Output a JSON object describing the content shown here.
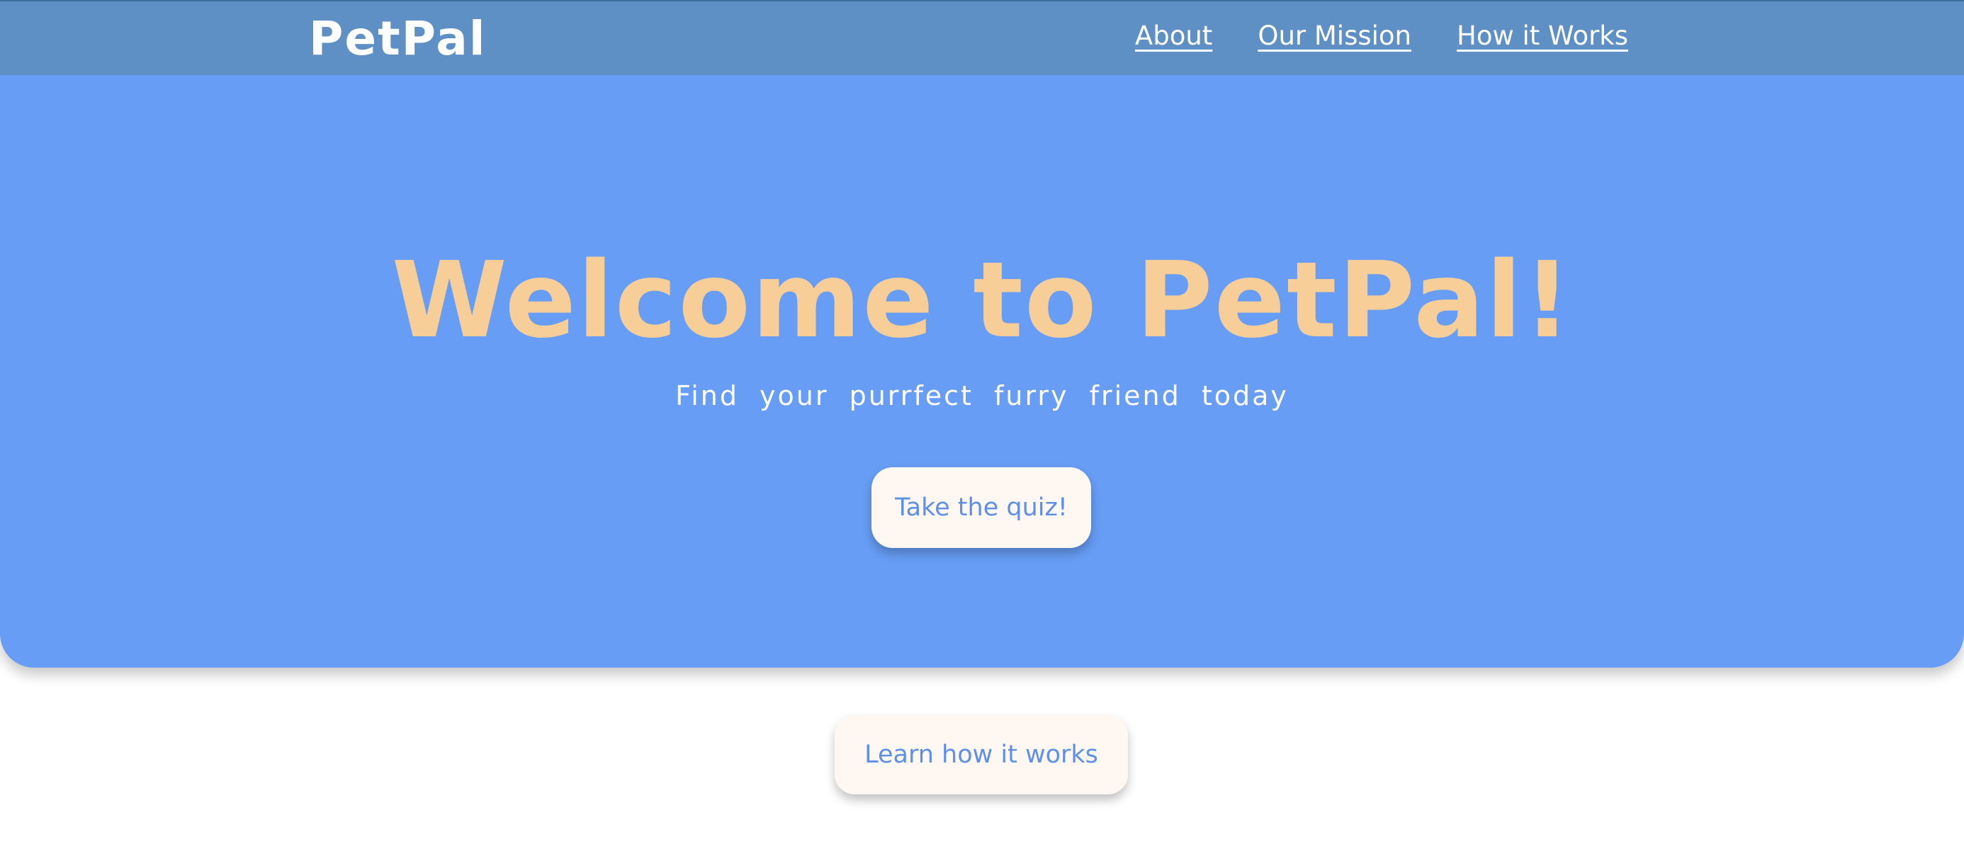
{
  "nav": {
    "logo": "PetPal",
    "links": [
      "About",
      "Our Mission",
      "How it Works"
    ]
  },
  "hero": {
    "title": "Welcome to PetPal!",
    "subtitle": "Find your purrfect furry friend today",
    "cta_label": "Take the quiz!"
  },
  "secondary": {
    "cta_label": "Learn how it works"
  },
  "colors": {
    "navbar": "#5f90c5",
    "hero_background": "#679df5",
    "title_accent": "#f7cd98",
    "button_background": "#fff7f2",
    "button_text": "#5f90e8",
    "page_background": "#ffffff"
  }
}
